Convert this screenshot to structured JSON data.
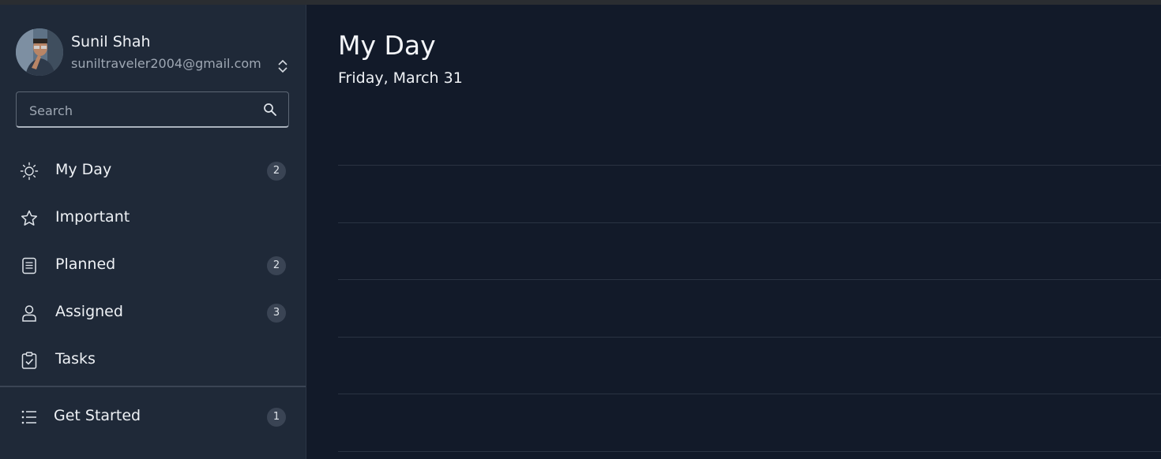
{
  "account": {
    "name": "Sunil Shah",
    "email": "suniltraveler2004@gmail.com"
  },
  "search": {
    "placeholder": "Search",
    "value": ""
  },
  "nav": {
    "items": [
      {
        "label": "My Day",
        "icon": "sun-icon",
        "count": "2"
      },
      {
        "label": "Important",
        "icon": "star-icon",
        "count": ""
      },
      {
        "label": "Planned",
        "icon": "calendar-list-icon",
        "count": "2"
      },
      {
        "label": "Assigned",
        "icon": "person-icon",
        "count": "3"
      },
      {
        "label": "Tasks",
        "icon": "clipboard-check-icon",
        "count": ""
      }
    ],
    "lists": [
      {
        "label": "Get Started",
        "icon": "list-icon",
        "count": "1"
      }
    ]
  },
  "main": {
    "title": "My Day",
    "date": "Friday, March 31"
  },
  "colors": {
    "sidebar_bg": "#1f2938",
    "main_bg": "#121a29",
    "badge_bg": "#3a4454",
    "text": "#eef1f5",
    "muted_text": "#9ea7b3"
  }
}
